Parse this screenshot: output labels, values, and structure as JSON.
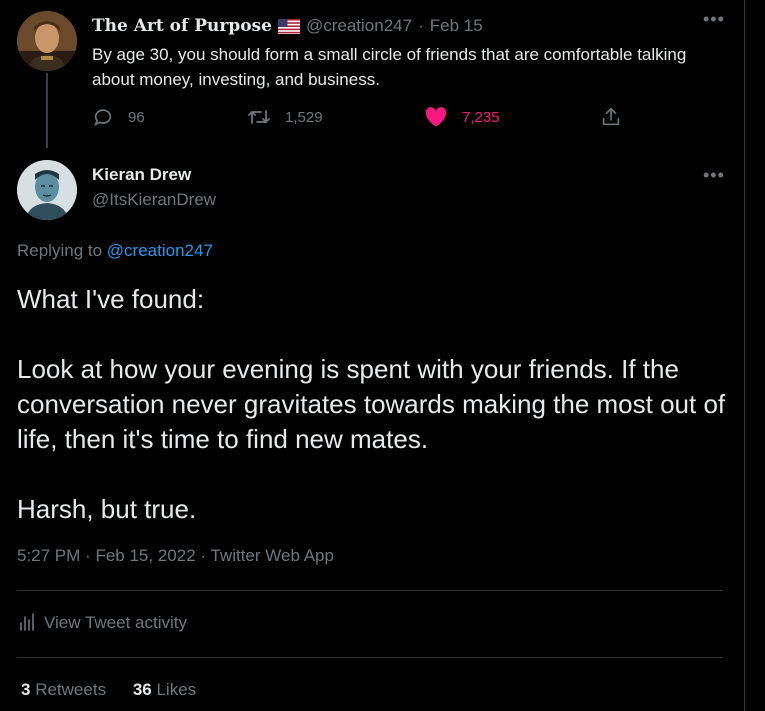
{
  "parent_tweet": {
    "author_name": "The Art of Purpose",
    "handle": "@creation247",
    "separator": "·",
    "date": "Feb 15",
    "text": "By age 30, you should form a small circle of friends that are comfortable talking about money, investing, and business.",
    "replies": "96",
    "retweets": "1,529",
    "likes": "7,235",
    "liked": true
  },
  "main_tweet": {
    "author_name": "Kieran Drew",
    "handle": "@ItsKieranDrew",
    "replying_prefix": "Replying to",
    "replying_to": "@creation247",
    "paragraphs": [
      "What I've found:",
      "Look at how your evening is spent with your friends. If the conversation never gravitates towards making the most out of life, then it's time to find new mates.",
      "Harsh, but true."
    ],
    "time": "5:27 PM",
    "dot": "·",
    "date": "Feb 15, 2022",
    "source": "Twitter Web App",
    "activity_label": "View Tweet activity",
    "retweet_count": "3",
    "retweet_label": "Retweets",
    "like_count": "36",
    "like_label": "Likes"
  },
  "colors": {
    "background": "#000000",
    "text": "#e7e9ea",
    "muted": "#71767b",
    "link": "#1d9bf0",
    "like": "#f91880",
    "divider": "#2f3336"
  },
  "icons": {
    "more": "more-options-icon",
    "reply": "reply-icon",
    "retweet": "retweet-icon",
    "like": "heart-icon",
    "share": "share-icon",
    "activity": "bar-chart-icon",
    "flag": "us-flag-icon"
  }
}
